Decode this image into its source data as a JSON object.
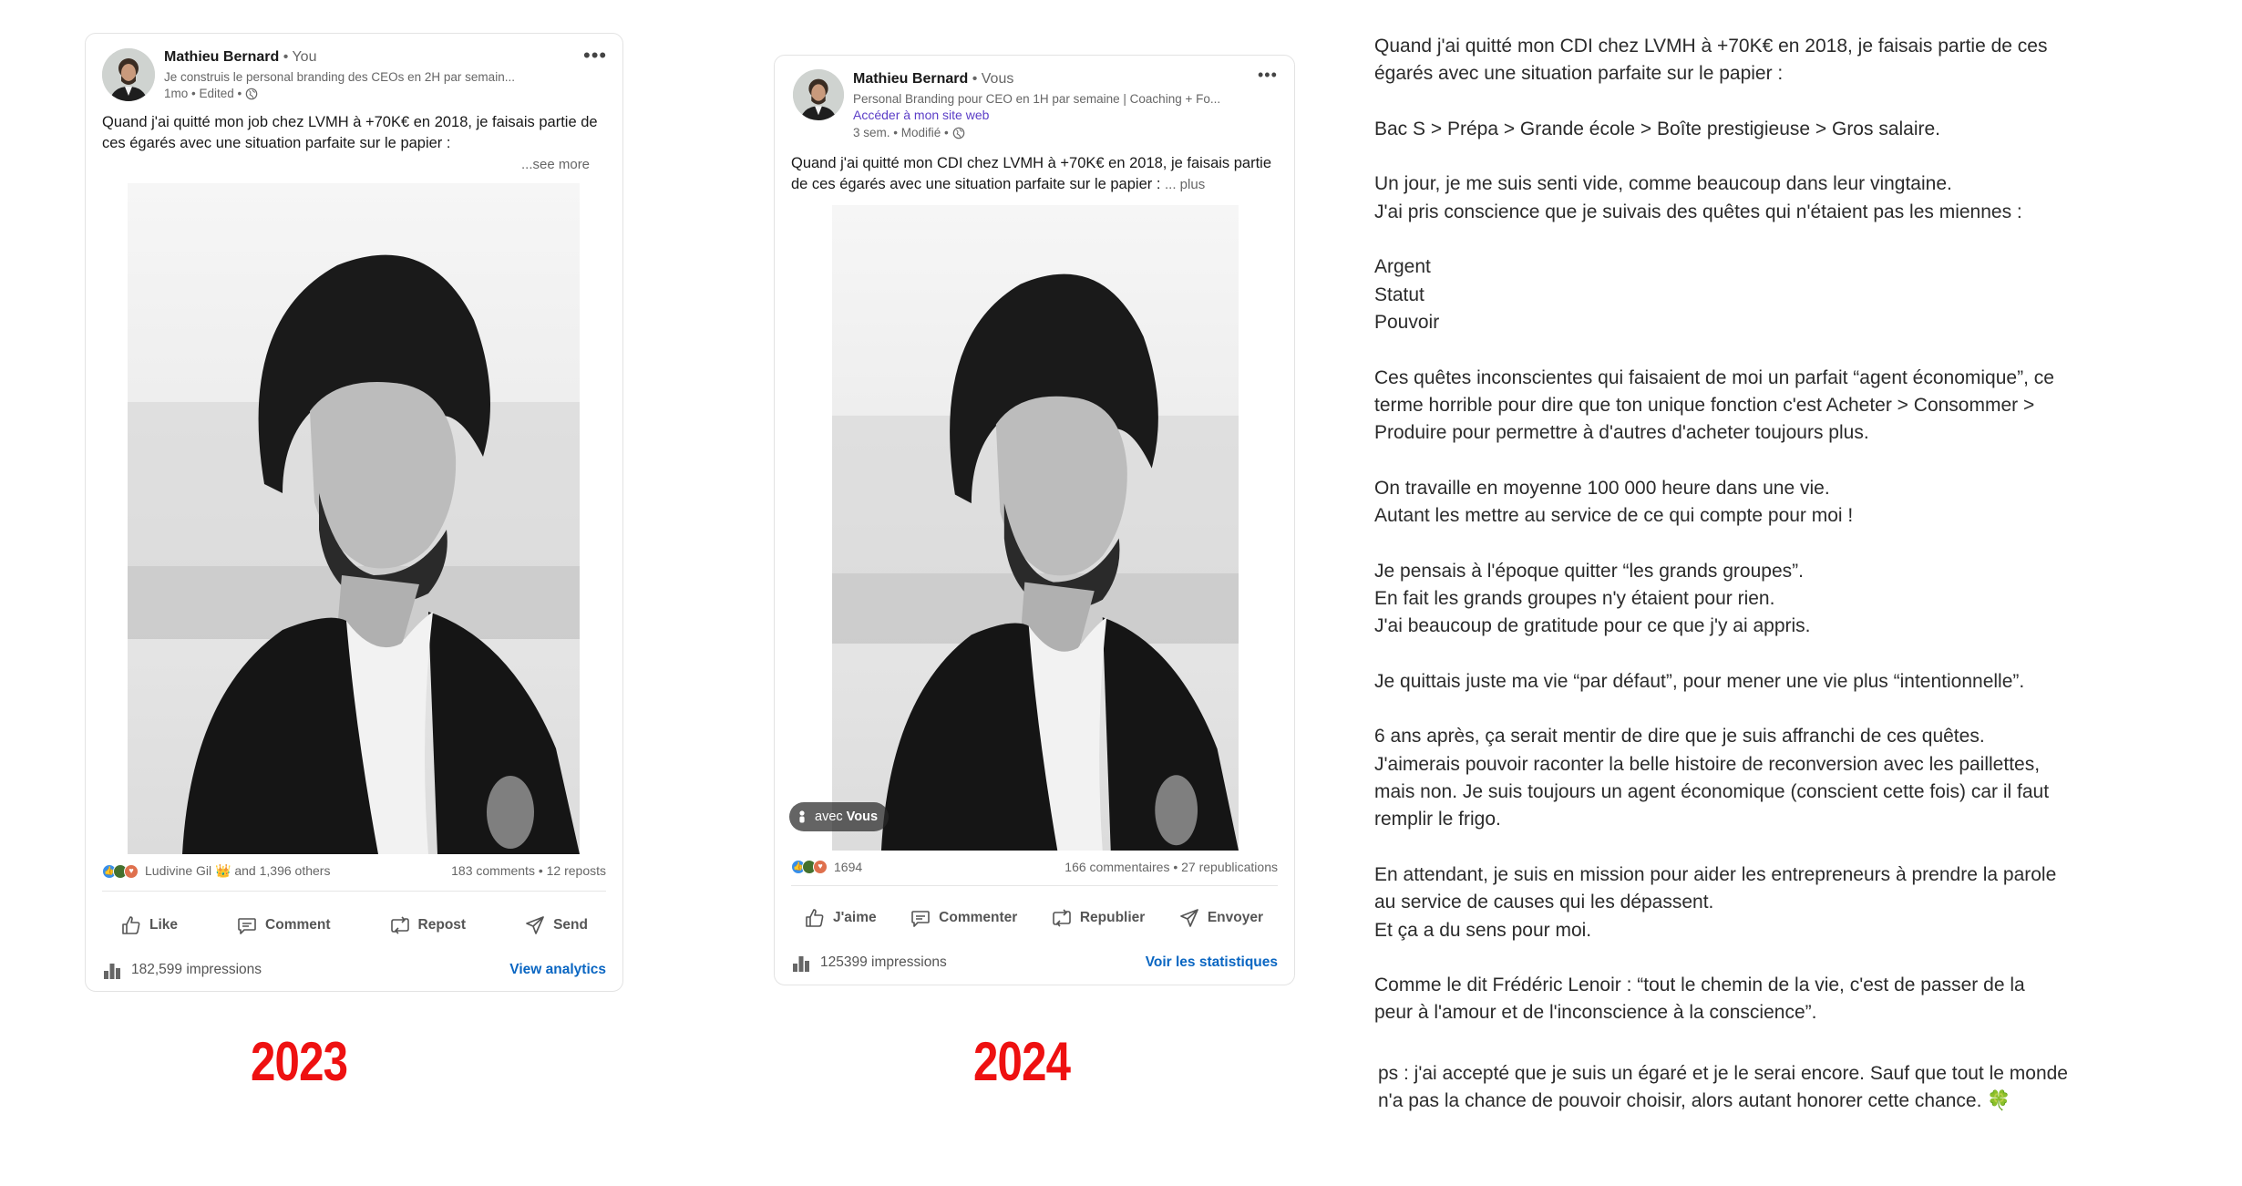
{
  "post_2023": {
    "author": "Mathieu Bernard",
    "relation": "You",
    "tagline": "Je construis le personal branding des CEOs en 2H par semain...",
    "meta": "1mo • Edited •",
    "text": "Quand j'ai quitté mon job chez LVMH à +70K€ en 2018, je faisais partie de ces égarés avec une situation parfaite sur le papier :",
    "see_more": "...see more",
    "reactions_text": "Ludivine Gil 👑 and 1,396 others",
    "stats": "183 comments • 12 reposts",
    "actions": [
      "Like",
      "Comment",
      "Repost",
      "Send"
    ],
    "impressions": "182,599 impressions",
    "analytics": "View analytics"
  },
  "post_2024": {
    "author": "Mathieu Bernard",
    "relation": "Vous",
    "tagline": "Personal Branding pour CEO en 1H par semaine | Coaching + Fo...",
    "website": "Accéder à mon site web",
    "meta": "3 sem. • Modifié •",
    "text": "Quand j'ai quitté mon CDI chez LVMH à +70K€ en 2018, je faisais partie de ces égarés avec une situation parfaite sur le papier :",
    "see_more": "... plus",
    "tag_prefix": "avec",
    "tag_name": "Vous",
    "reactions_count": "1694",
    "stats": "166 commentaires • 27 republications",
    "actions": [
      "J'aime",
      "Commenter",
      "Republier",
      "Envoyer"
    ],
    "impressions": "125399 impressions",
    "analytics": "Voir les statistiques"
  },
  "labels": {
    "year_2023": "2023",
    "year_2024": "2024"
  },
  "colors": {
    "year_label": "#ee1111",
    "link_blue": "#0a66c2",
    "website_purple": "#5b3ec7"
  },
  "article": {
    "paragraphs": [
      [
        "Quand j'ai quitté mon CDI chez LVMH à +70K€ en 2018, je faisais partie de ces",
        "égarés avec une situation parfaite sur le papier :"
      ],
      [
        "Bac S > Prépa > Grande école > Boîte prestigieuse > Gros salaire."
      ],
      [
        "Un jour, je me suis senti vide, comme beaucoup dans leur vingtaine.",
        "J'ai pris conscience que je suivais des quêtes qui n'étaient pas les miennes :"
      ],
      [
        "Argent",
        "Statut",
        "Pouvoir"
      ],
      [
        "Ces quêtes inconscientes qui faisaient de moi un parfait “agent économique”, ce",
        "terme horrible pour dire que ton unique fonction c'est Acheter > Consommer >",
        "Produire pour permettre à d'autres d'acheter toujours plus."
      ],
      [
        "On travaille en moyenne 100 000 heure dans une vie.",
        "Autant les mettre au service de ce qui compte pour moi !"
      ],
      [
        "Je pensais à l'époque quitter “les grands groupes”.",
        "En fait les grands groupes n'y étaient pour rien.",
        "J'ai beaucoup de gratitude pour ce que j'y ai appris."
      ],
      [
        "Je quittais juste ma vie “par défaut”, pour mener une vie plus “intentionnelle”."
      ],
      [
        "6 ans après, ça serait mentir de dire que je suis affranchi de ces quêtes.",
        "J'aimerais pouvoir raconter la belle histoire de reconversion avec les paillettes,",
        "mais non. Je suis toujours un agent économique (conscient cette fois) car il faut",
        "remplir le frigo."
      ],
      [
        "En attendant, je suis en mission pour aider les entrepreneurs à prendre la parole",
        "au service de causes qui les dépassent.",
        "Et ça a du sens pour moi."
      ],
      [
        "Comme le dit Frédéric Lenoir : “tout le chemin de la vie, c'est de passer de la",
        "peur à l'amour et de l'inconscience à la conscience”."
      ]
    ],
    "ps": [
      "ps : j'ai accepté que je suis un égaré et je le serai encore. Sauf que tout le monde",
      "n'a pas la chance de pouvoir choisir, alors autant honorer cette chance. 🍀"
    ]
  }
}
